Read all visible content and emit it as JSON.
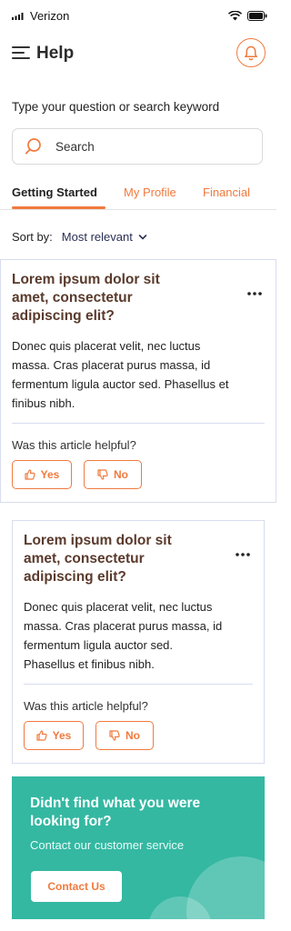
{
  "status_bar": {
    "carrier": "Verizon"
  },
  "header": {
    "title": "Help"
  },
  "search": {
    "prompt": "Type your question or search keyword",
    "placeholder": "Search",
    "value": ""
  },
  "tabs": [
    {
      "label": "Getting Started",
      "active": true
    },
    {
      "label": "My Profile",
      "active": false
    },
    {
      "label": "Financial",
      "active": false
    }
  ],
  "sort": {
    "label": "Sort by:",
    "value": "Most relevant"
  },
  "articles": [
    {
      "title": "Lorem ipsum dolor sit amet, consectetur adipiscing elit?",
      "body": [
        "Donec quis placerat velit, nec luctus",
        "massa. Cras placerat purus massa, id",
        "fermentum ligula auctor sed. Phasellus et",
        "finibus nibh."
      ],
      "helpful_prompt": "Was this article helpful?",
      "yes_label": "Yes",
      "no_label": "No"
    },
    {
      "title": "Lorem ipsum dolor sit amet, consectetur adipiscing elit?",
      "body": [
        "Donec quis placerat velit, nec luctus",
        "massa. Cras placerat purus massa, id",
        "fermentum ligula auctor sed.",
        "Phasellus et finibus nibh."
      ],
      "helpful_prompt": "Was this article helpful?",
      "yes_label": "Yes",
      "no_label": "No"
    }
  ],
  "cta": {
    "title": "Didn't find what you were looking for?",
    "subtitle": "Contact our customer service",
    "button_label": "Contact Us"
  },
  "colors": {
    "accent": "#f07a3e",
    "teal": "#34b8a2",
    "title_brown": "#5a3a2c"
  }
}
